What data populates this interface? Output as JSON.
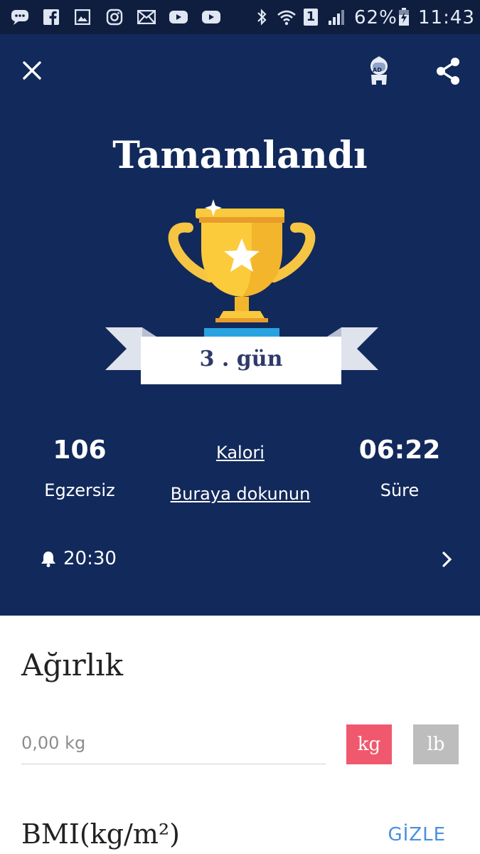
{
  "statusbar": {
    "battery": "62%",
    "time": "11:43",
    "sim": "1",
    "left_icons": [
      "messages-icon",
      "facebook-icon",
      "gallery-icon",
      "instagram-icon",
      "mail-icon",
      "youtube-icon",
      "youtube-icon"
    ]
  },
  "header": {
    "close_icon": "close-icon",
    "ad_icon": "ad-astronaut-icon",
    "ad_text": "AD",
    "share_icon": "share-icon"
  },
  "hero": {
    "title": "Tamamlandı",
    "day_label": "3 . gün"
  },
  "stats": {
    "exercises_value": "106",
    "exercises_label": "Egzersiz",
    "calories_label": "Kalori",
    "calories_action": "Buraya dokunun",
    "duration_value": "06:22",
    "duration_label": "Süre"
  },
  "reminder": {
    "time": "20:30"
  },
  "weight": {
    "title": "Ağırlık",
    "placeholder": "0,00 kg",
    "unit_kg": "kg",
    "unit_lb": "lb"
  },
  "bmi": {
    "title": "BMI(kg/m²)",
    "hide_label": "GİZLE"
  },
  "colors": {
    "hero_bg": "#12295b",
    "statusbar_bg": "#0f1e3f",
    "kg_active": "#f0586e",
    "lb_inactive": "#bdbdbd",
    "accent_link": "#4a8fe0",
    "trophy_gold": "#f9c93e"
  }
}
